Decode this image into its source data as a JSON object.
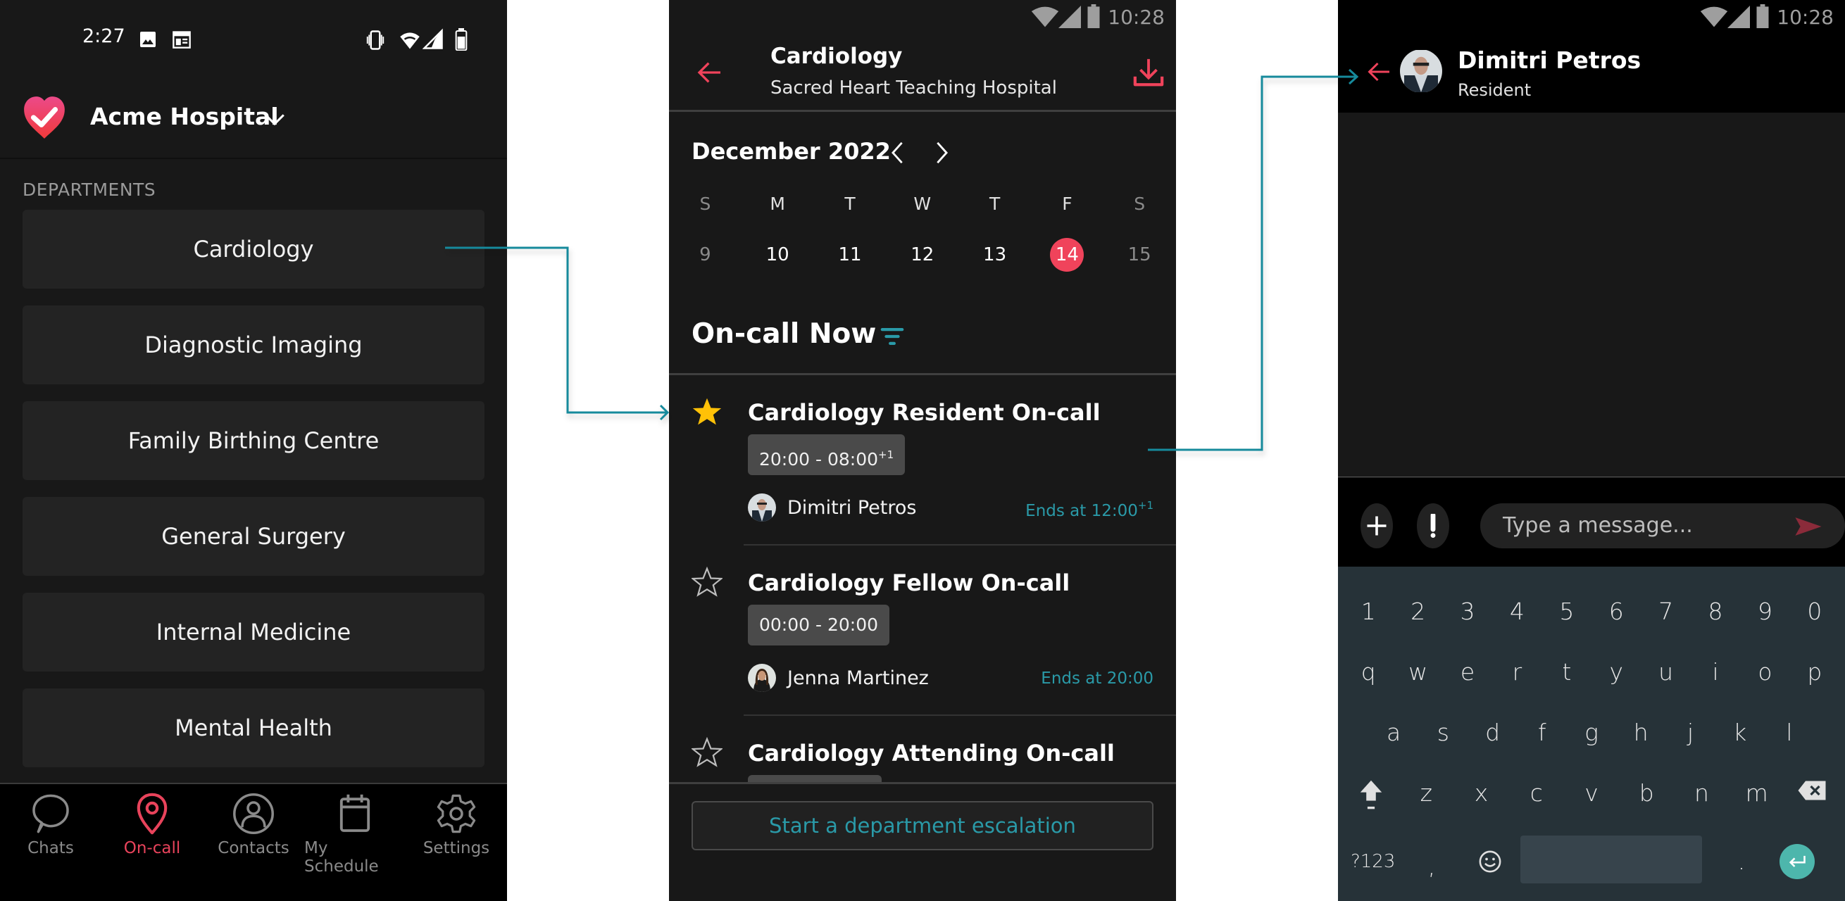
{
  "left": {
    "status_bar": {
      "time": "2:27",
      "icons_left": [
        "image-icon",
        "calendar-notification-icon"
      ],
      "icons_right": [
        "vibrate-icon",
        "wifi-icon",
        "signal-icon",
        "battery-icon"
      ]
    },
    "header": {
      "hospital_name": "Acme Hospital",
      "logo": "heart-check-logo",
      "dropdown_icon": "chevron-down-icon"
    },
    "departments_label": "DEPARTMENTS",
    "departments": [
      {
        "label": "Cardiology"
      },
      {
        "label": "Diagnostic Imaging"
      },
      {
        "label": "Family Birthing Centre"
      },
      {
        "label": "General Surgery"
      },
      {
        "label": "Internal Medicine"
      },
      {
        "label": "Mental Health"
      }
    ],
    "nav": [
      {
        "label": "Chats",
        "icon": "chat-bubble-icon",
        "active": false
      },
      {
        "label": "On-call",
        "icon": "location-pin-icon",
        "active": true
      },
      {
        "label": "Contacts",
        "icon": "person-circle-icon",
        "active": false
      },
      {
        "label": "My Schedule",
        "icon": "calendar-icon",
        "active": false
      },
      {
        "label": "Settings",
        "icon": "gear-icon",
        "active": false
      }
    ]
  },
  "middle": {
    "status_bar": {
      "time": "10:28"
    },
    "header": {
      "title": "Cardiology",
      "subtitle": "Sacred Heart Teaching Hospital"
    },
    "calendar": {
      "month_label": "December 2022",
      "weekdays": [
        "S",
        "M",
        "T",
        "W",
        "T",
        "F",
        "S"
      ],
      "dates": [
        "9",
        "10",
        "11",
        "12",
        "13",
        "14",
        "15"
      ],
      "selected_date": "14"
    },
    "oncall_title": "On-call Now",
    "roles": [
      {
        "title": "Cardiology Resident On-call",
        "starred": true,
        "time": "20:00 - 08:00",
        "time_sup": "+1",
        "person": "Dimitri Petros",
        "ends": "Ends at 12:00",
        "ends_sup": "+1"
      },
      {
        "title": "Cardiology Fellow On-call",
        "starred": false,
        "time": "00:00 - 20:00",
        "time_sup": "",
        "person": "Jenna Martinez",
        "ends": "Ends at 20:00",
        "ends_sup": ""
      },
      {
        "title": "Cardiology Attending On-call",
        "starred": false,
        "time": "",
        "time_sup": "",
        "person": "",
        "ends": "",
        "ends_sup": ""
      }
    ],
    "escalation_button": "Start a department escalation"
  },
  "right": {
    "status_bar": {
      "time": "10:28"
    },
    "contact": {
      "name": "Dimitri Petros",
      "role": "Resident"
    },
    "message_input": {
      "placeholder": "Type a message...",
      "value": ""
    },
    "keyboard": {
      "row_numbers": [
        "1",
        "2",
        "3",
        "4",
        "5",
        "6",
        "7",
        "8",
        "9",
        "0"
      ],
      "row_1": [
        "q",
        "w",
        "e",
        "r",
        "t",
        "y",
        "u",
        "i",
        "o",
        "p"
      ],
      "row_2": [
        "a",
        "s",
        "d",
        "f",
        "g",
        "h",
        "j",
        "k",
        "l"
      ],
      "row_3": [
        "z",
        "x",
        "c",
        "v",
        "b",
        "n",
        "m"
      ],
      "symbols_key": "?123",
      "comma_key": ",",
      "period_key": "."
    }
  },
  "colors": {
    "accent_red": "#f0435b",
    "accent_teal": "#2a9aa8",
    "star_yellow": "#ffc107",
    "keyboard_bg": "#263238",
    "enter_key": "#4db6ac"
  }
}
